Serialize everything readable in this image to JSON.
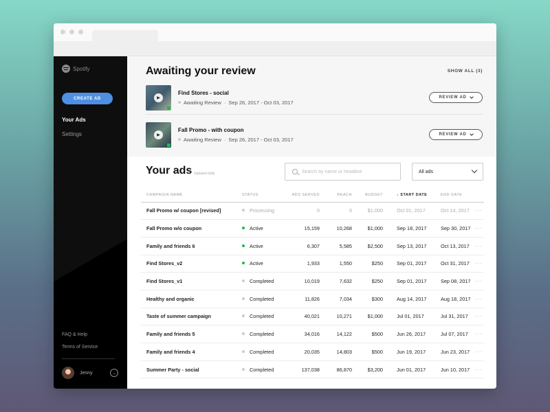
{
  "app": {
    "brand": "Spotify"
  },
  "sidebar": {
    "create_label": "CREATE AD",
    "items": [
      {
        "label": "Your Ads",
        "active": true
      },
      {
        "label": "Settings",
        "active": false
      }
    ],
    "footer": {
      "faq": "FAQ & Help",
      "terms": "Terms of Service"
    },
    "user": {
      "name": "Jenny"
    }
  },
  "review": {
    "title": "Awaiting your review",
    "show_all": "SHOW ALL (3)",
    "button_label": "REVIEW AD",
    "items": [
      {
        "name": "Find Stores - social",
        "status": "Awaiting Review",
        "dates": "Sep 26, 2017 - Oct 03, 2017"
      },
      {
        "name": "Fall Promo - with coupon",
        "status": "Awaiting Review",
        "dates": "Sep 26, 2017 - Oct 03, 2017"
      }
    ]
  },
  "ads": {
    "title": "Your ads",
    "updated": "Updated daily",
    "search_placeholder": "Search by name or headline",
    "filter_value": "All ads",
    "columns": [
      "CAMPAIGN NAME",
      "STATUS",
      "ADS SERVED",
      "REACH",
      "BUDGET",
      "START DATE",
      "END DATE"
    ],
    "status_colors": {
      "Processing": "#cccccc",
      "Active": "#1db954",
      "Completed": "#cccccc"
    },
    "rows": [
      {
        "name": "Fall Promo w/ coupon [revised]",
        "status": "Processing",
        "served": "0",
        "reach": "0",
        "budget": "$1,000",
        "start": "Oct 01, 2017",
        "end": "Oct 14, 2017",
        "muted": true
      },
      {
        "name": "Fall Promo w/o coupon",
        "status": "Active",
        "served": "15,159",
        "reach": "10,268",
        "budget": "$1,000",
        "start": "Sep 18, 2017",
        "end": "Sep 30, 2017"
      },
      {
        "name": "Family and friends 6",
        "status": "Active",
        "served": "6,307",
        "reach": "5,585",
        "budget": "$2,500",
        "start": "Sep 13, 2017",
        "end": "Oct 13, 2017"
      },
      {
        "name": "Find Stores_v2",
        "status": "Active",
        "served": "1,933",
        "reach": "1,550",
        "budget": "$250",
        "start": "Sep 01, 2017",
        "end": "Oct 31, 2017"
      },
      {
        "name": "Find Stores_v1",
        "status": "Completed",
        "served": "10,019",
        "reach": "7,632",
        "budget": "$250",
        "start": "Sep 01, 2017",
        "end": "Sep 08, 2017"
      },
      {
        "name": "Healthy and organic",
        "status": "Completed",
        "served": "11,826",
        "reach": "7,034",
        "budget": "$300",
        "start": "Aug 14, 2017",
        "end": "Aug 18, 2017"
      },
      {
        "name": "Taste of summer campaign",
        "status": "Completed",
        "served": "40,021",
        "reach": "10,271",
        "budget": "$1,000",
        "start": "Jul 01, 2017",
        "end": "Jul 31, 2017"
      },
      {
        "name": "Family and friends 5",
        "status": "Completed",
        "served": "34,016",
        "reach": "14,122",
        "budget": "$500",
        "start": "Jun 26, 2017",
        "end": "Jul 07, 2017"
      },
      {
        "name": "Family and friends 4",
        "status": "Completed",
        "served": "20,035",
        "reach": "14,803",
        "budget": "$500",
        "start": "Jun 19, 2017",
        "end": "Jun 23, 2017"
      },
      {
        "name": "Summer Party - social",
        "status": "Completed",
        "served": "137,038",
        "reach": "86,870",
        "budget": "$3,200",
        "start": "Jun 01, 2017",
        "end": "Jun 10, 2017"
      }
    ]
  }
}
